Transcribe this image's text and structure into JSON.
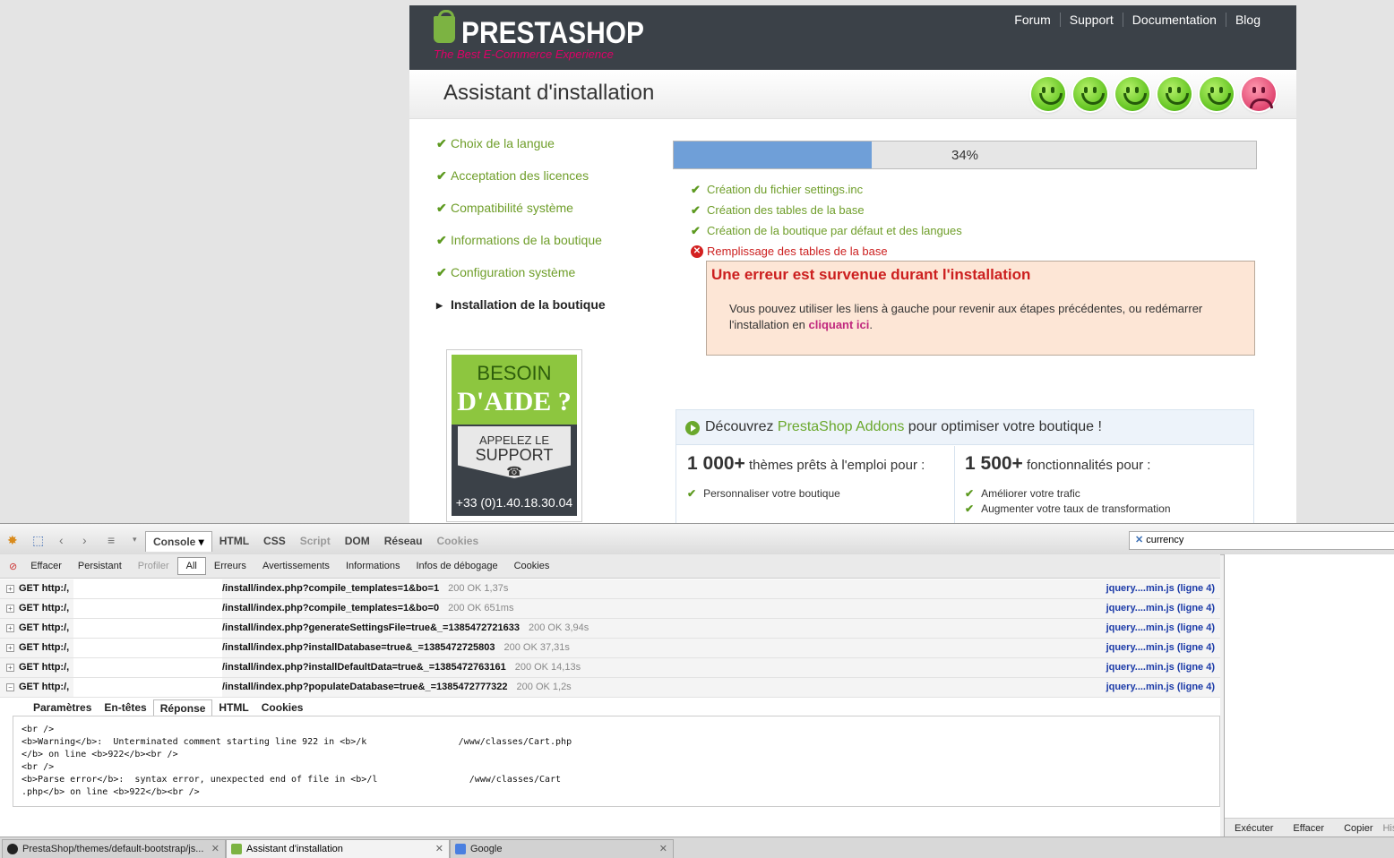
{
  "installer": {
    "logo_text": "PRESTASHOP",
    "logo_tagline": "The Best E-Commerce Experience",
    "nav": [
      "Forum",
      "Support",
      "Documentation",
      "Blog"
    ],
    "title": "Assistant d'installation",
    "progress_value": 34,
    "progress_label": "34%",
    "steps": [
      {
        "label": "Choix de la langue",
        "state": "done"
      },
      {
        "label": "Acceptation des licences",
        "state": "done"
      },
      {
        "label": "Compatibilité système",
        "state": "done"
      },
      {
        "label": "Informations de la boutique",
        "state": "done"
      },
      {
        "label": "Configuration système",
        "state": "done"
      },
      {
        "label": "Installation de la boutique",
        "state": "active"
      }
    ],
    "tasks": [
      {
        "label": "Création du fichier settings.inc",
        "state": "ok"
      },
      {
        "label": "Création des tables de la base",
        "state": "ok"
      },
      {
        "label": "Création de la boutique par défaut et des langues",
        "state": "ok"
      },
      {
        "label": "Remplissage des tables de la base",
        "state": "error"
      }
    ],
    "error": {
      "title": "Une erreur est survenue durant l'installation",
      "text_before": "Vous pouvez utiliser les liens à gauche pour revenir aux étapes précédentes, ou redémarrer l'installation en ",
      "link": "cliquant ici",
      "text_after": "."
    },
    "help": {
      "line1": "BESOIN",
      "line2": "D'AIDE ?",
      "line3": "APPELEZ LE",
      "line4": "SUPPORT",
      "phone": "+33 (0)1.40.18.30.04"
    },
    "addons": {
      "title_pre": "Découvrez ",
      "title_brand": "PrestaShop Addons",
      "title_post": " pour optimiser votre boutique !",
      "col1_num": "1 000+",
      "col1_text": " thèmes prêts à l'emploi pour :",
      "col1_items": [
        "Personnaliser votre boutique"
      ],
      "col2_num": "1 500+",
      "col2_text": " fonctionnalités pour :",
      "col2_items": [
        "Améliorer votre trafic",
        "Augmenter votre taux de transformation"
      ]
    },
    "smileys": [
      "happy",
      "happy",
      "happy",
      "happy",
      "happy",
      "sad"
    ],
    "colors": {
      "accent_green": "#6f9e2a",
      "error_red": "#cc1f1f",
      "header_dark": "#3b4148",
      "progress_blue": "#6f9fd8"
    }
  },
  "firebug": {
    "tabs": [
      {
        "label": "Console",
        "state": "active"
      },
      {
        "label": "HTML",
        "state": "normal"
      },
      {
        "label": "CSS",
        "state": "normal"
      },
      {
        "label": "Script",
        "state": "disabled"
      },
      {
        "label": "DOM",
        "state": "normal"
      },
      {
        "label": "Réseau",
        "state": "normal"
      },
      {
        "label": "Cookies",
        "state": "disabled"
      }
    ],
    "search_value": "currency",
    "filters": [
      {
        "label": "Effacer",
        "state": "normal"
      },
      {
        "label": "Persistant",
        "state": "normal"
      },
      {
        "label": "Profiler",
        "state": "disabled"
      },
      {
        "label": "All",
        "state": "active"
      },
      {
        "label": "Erreurs",
        "state": "normal"
      },
      {
        "label": "Avertissements",
        "state": "normal"
      },
      {
        "label": "Informations",
        "state": "normal"
      },
      {
        "label": "Infos de débogage",
        "state": "normal"
      },
      {
        "label": "Cookies",
        "state": "normal"
      }
    ],
    "requests": [
      {
        "method": "GET http:/,",
        "path": "/install/index.php?compile_templates=1&bo=1",
        "status": "200 OK 1,37s",
        "source": "jquery....min.js (ligne 4)",
        "expanded": false
      },
      {
        "method": "GET http:/,",
        "path": "/install/index.php?compile_templates=1&bo=0",
        "status": "200 OK 651ms",
        "source": "jquery....min.js (ligne 4)",
        "expanded": false
      },
      {
        "method": "GET http:/,",
        "path": "/install/index.php?generateSettingsFile=true&_=1385472721633",
        "status": "200 OK 3,94s",
        "source": "jquery....min.js (ligne 4)",
        "expanded": false
      },
      {
        "method": "GET http:/,",
        "path": "/install/index.php?installDatabase=true&_=1385472725803",
        "status": "200 OK 37,31s",
        "source": "jquery....min.js (ligne 4)",
        "expanded": false
      },
      {
        "method": "GET http:/,",
        "path": "/install/index.php?installDefaultData=true&_=1385472763161",
        "status": "200 OK 14,13s",
        "source": "jquery....min.js (ligne 4)",
        "expanded": false
      },
      {
        "method": "GET http:/,",
        "path": "/install/index.php?populateDatabase=true&_=1385472777322",
        "status": "200 OK 1,2s",
        "source": "jquery....min.js (ligne 4)",
        "expanded": true
      }
    ],
    "response_tabs": [
      {
        "label": "Paramètres",
        "state": "normal"
      },
      {
        "label": "En-têtes",
        "state": "normal"
      },
      {
        "label": "Réponse",
        "state": "active"
      },
      {
        "label": "HTML",
        "state": "normal"
      },
      {
        "label": "Cookies",
        "state": "normal"
      }
    ],
    "response_body": "<br />\n<b>Warning</b>:  Unterminated comment starting line 922 in <b>/k                 /www/classes/Cart.php\n</b> on line <b>922</b><br />\n<br />\n<b>Parse error</b>:  syntax error, unexpected end of file in <b>/l                 /www/classes/Cart\n.php</b> on line <b>922</b><br />",
    "side_actions": [
      "Exécuter",
      "Effacer",
      "Copier",
      "His"
    ]
  },
  "browser_tabs": [
    {
      "label": "PrestaShop/themes/default-bootstrap/js...",
      "active": false
    },
    {
      "label": "Assistant d'installation",
      "active": true
    },
    {
      "label": "Google",
      "active": false
    }
  ]
}
